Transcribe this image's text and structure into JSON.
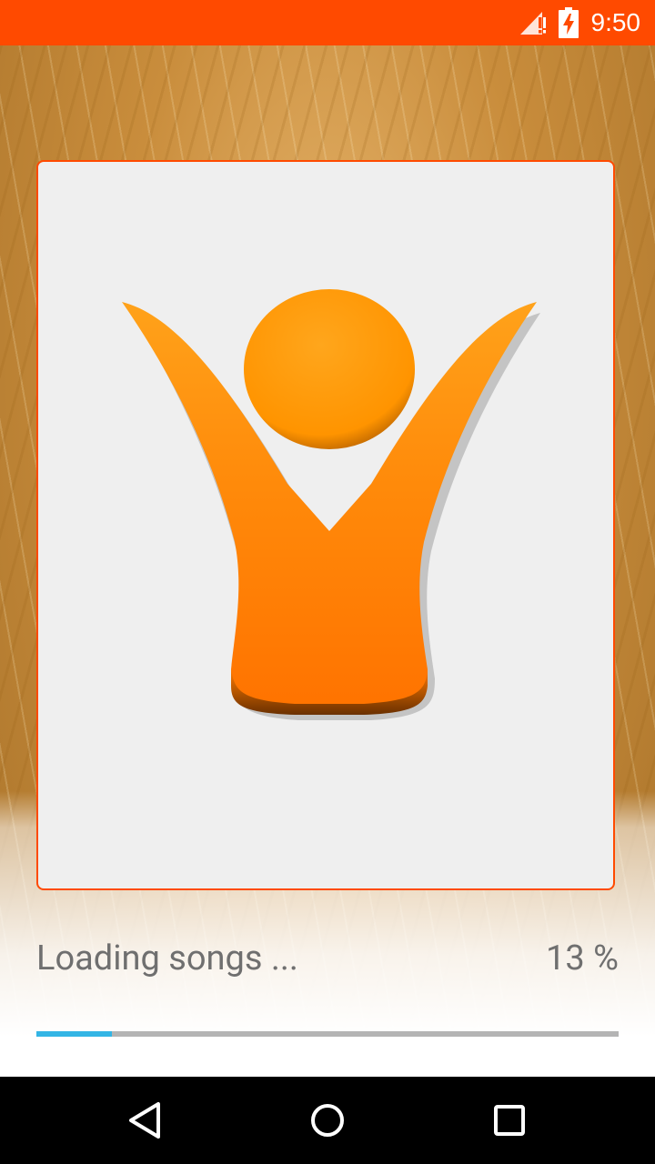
{
  "status_bar": {
    "time": "9:50",
    "icons": [
      "signal-warning-icon",
      "battery-charging-icon"
    ],
    "color": "#ff4a00"
  },
  "logo": {
    "icon": "person-raised-arms-logo",
    "color": "#ff8a00"
  },
  "loading": {
    "label": "Loading songs ...",
    "percent_text": "13 %",
    "progress": 0.13,
    "progress_color": "#33b5e5"
  },
  "nav_bar": {
    "icons": [
      "back-icon",
      "home-icon",
      "recents-icon"
    ]
  }
}
